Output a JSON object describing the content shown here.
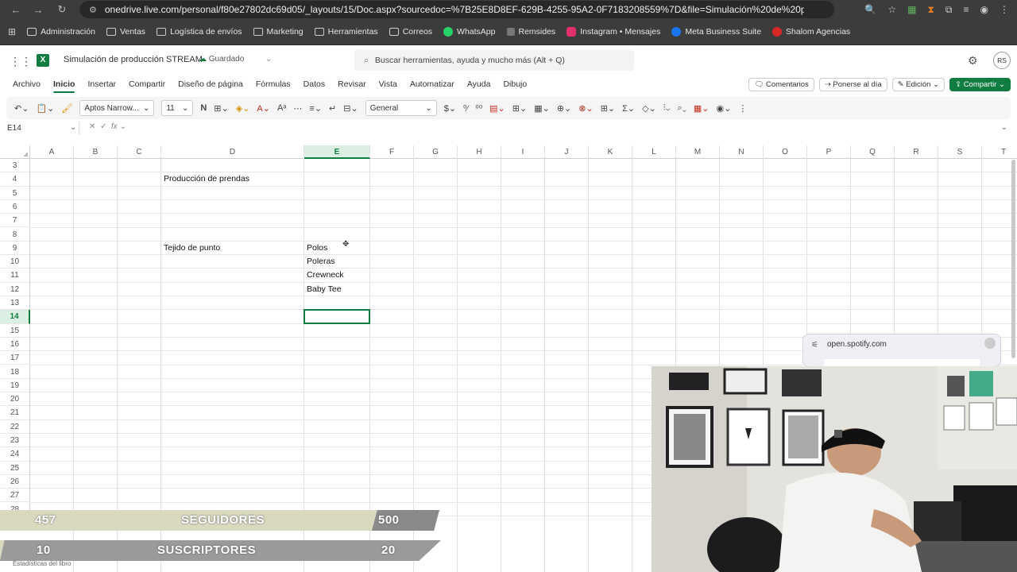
{
  "browser": {
    "url": "onedrive.live.com/personal/f80e27802dc69d05/_layouts/15/Doc.aspx?sourcedoc=%7B25E8D8EF-629B-4255-95A2-0F7183208559%7D&file=Simulación%20de%20produ...",
    "bookmarks": [
      "Administración",
      "Ventas",
      "Logística de envíos",
      "Marketing",
      "Herramientas",
      "Correos",
      "WhatsApp",
      "Remsides",
      "Instagram • Mensajes",
      "Meta Business Suite",
      "Shalom Agencias"
    ]
  },
  "app": {
    "title": "Simulación de producción STREAM",
    "saved_status": "Guardado",
    "search_placeholder": "Buscar herramientas, ayuda y mucho más (Alt + Q)",
    "user_initials": "RS"
  },
  "menu": {
    "tabs": [
      "Archivo",
      "Inicio",
      "Insertar",
      "Compartir",
      "Diseño de página",
      "Fórmulas",
      "Datos",
      "Revisar",
      "Vista",
      "Automatizar",
      "Ayuda",
      "Dibujo"
    ],
    "active_tab": "Inicio",
    "comments": "Comentarios",
    "catch_up": "Ponerse al día",
    "editing": "Edición",
    "share": "Compartir"
  },
  "ribbon": {
    "font_name": "Aptos Narrow...",
    "font_size": "11",
    "bold": "N",
    "number_format": "General"
  },
  "formula_bar": {
    "cell_ref": "E14",
    "fx": "fx",
    "value": ""
  },
  "sheet": {
    "columns": [
      "A",
      "B",
      "C",
      "D",
      "E",
      "F",
      "G",
      "H",
      "I",
      "J",
      "K",
      "L",
      "M",
      "N",
      "O",
      "P",
      "Q",
      "R",
      "S",
      "T"
    ],
    "selected_column": "E",
    "rows": [
      "3",
      "4",
      "5",
      "6",
      "7",
      "8",
      "9",
      "10",
      "11",
      "12",
      "13",
      "14",
      "15",
      "16",
      "17",
      "18",
      "19",
      "20",
      "21",
      "22",
      "23",
      "24",
      "25",
      "26",
      "27",
      "28"
    ],
    "selected_row": "14",
    "cells": {
      "D4": "Producción de prendas",
      "D9": "Tejido de punto",
      "E9": "Polos",
      "E10": "Poleras",
      "E11": "Crewneck",
      "E12": "Baby Tee"
    }
  },
  "stream_overlay": {
    "followers": {
      "current": "457",
      "label": "SEGUIDORES",
      "goal": "500"
    },
    "subscribers": {
      "current": "10",
      "label": "SUSCRIPTORES",
      "goal": "20"
    },
    "workbook_stats": "Estadísticas del libro"
  },
  "popup": {
    "domain": "open.spotify.com"
  }
}
